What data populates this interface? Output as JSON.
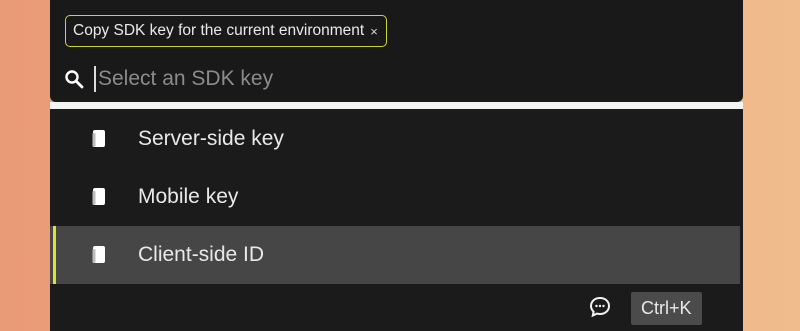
{
  "context_chip": {
    "label": "Copy SDK key for the current environment",
    "close_symbol": "×",
    "accent_color": "#c8d832"
  },
  "search": {
    "placeholder": "Select an SDK key",
    "icon": "search-icon"
  },
  "results": [
    {
      "label": "Server-side key",
      "icon": "document-icon",
      "active": false
    },
    {
      "label": "Mobile key",
      "icon": "document-icon",
      "active": false
    },
    {
      "label": "Client-side ID",
      "icon": "document-icon",
      "active": true
    }
  ],
  "footer": {
    "feedback_icon": "chat-bubble-icon",
    "shortcut": "Ctrl+K"
  },
  "colors": {
    "panel_bg": "#1b1b1b",
    "active_bg": "#464646",
    "accent": "#d4e62f",
    "text": "#e9e9e9"
  }
}
